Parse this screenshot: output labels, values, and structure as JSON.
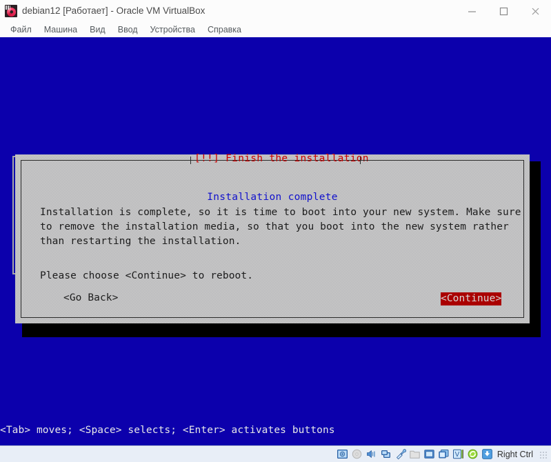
{
  "window": {
    "title": "debian12 [Работает] - Oracle VM VirtualBox",
    "app_icon": "virtualbox-icon",
    "controls": {
      "minimize": "minimize-button",
      "maximize": "maximize-button",
      "close": "close-button"
    }
  },
  "menubar": {
    "items": [
      {
        "label": "Файл"
      },
      {
        "label": "Машина"
      },
      {
        "label": "Вид"
      },
      {
        "label": "Ввод"
      },
      {
        "label": "Устройства"
      },
      {
        "label": "Справка"
      }
    ]
  },
  "vm_screen": {
    "background_color": "#0c00ac",
    "dialog": {
      "title": "[!!] Finish the installation",
      "title_color": "#cc0000",
      "subtitle": "Installation complete",
      "subtitle_color": "#1111cc",
      "body": "Installation is complete, so it is time to boot into your new system. Make sure to remove the installation media, so that you boot into the new system rather than restarting the installation.",
      "prompt": "Please choose <Continue> to reboot.",
      "buttons": {
        "go_back": "<Go Back>",
        "continue": "<Continue>",
        "continue_selected": true,
        "selected_bg": "#aa0000"
      },
      "background_color": "#c3c3c3"
    },
    "help_line": "<Tab> moves; <Space> selects; <Enter> activates buttons"
  },
  "statusbar": {
    "icons": [
      {
        "name": "hard-disk-icon"
      },
      {
        "name": "optical-disk-icon"
      },
      {
        "name": "audio-icon"
      },
      {
        "name": "network-icon"
      },
      {
        "name": "usb-icon"
      },
      {
        "name": "shared-folders-icon"
      },
      {
        "name": "display-icon"
      },
      {
        "name": "recording-icon"
      },
      {
        "name": "virtualbox-features-icon"
      },
      {
        "name": "mouse-integration-icon"
      },
      {
        "name": "host-key-icon"
      }
    ],
    "host_key": "Right Ctrl"
  }
}
